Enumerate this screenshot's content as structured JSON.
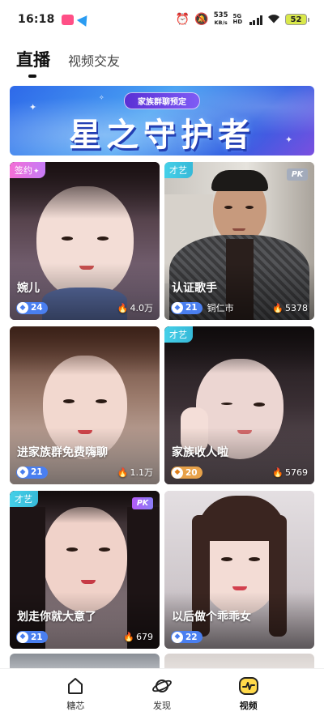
{
  "status_bar": {
    "time": "16:18",
    "net_speed_value": "535",
    "net_speed_unit": "KB/s",
    "network_type": "5G HD",
    "battery": "52"
  },
  "tabs": [
    {
      "label": "直播",
      "active": true
    },
    {
      "label": "视频交友",
      "active": false
    }
  ],
  "banner": {
    "pill_text": "家族群聊预定",
    "title": "星之守护者"
  },
  "cards": [
    {
      "tag": "签约",
      "tag_style": "pink",
      "pk": false,
      "title": "婉儿",
      "level": "24",
      "level_style": "blue",
      "city": "",
      "heat": "4.0万"
    },
    {
      "tag": "才艺",
      "tag_style": "teal",
      "pk": true,
      "pk_style": "grey",
      "title": "认证歌手",
      "level": "21",
      "level_style": "blue",
      "city": "铜仁市",
      "heat": "5378"
    },
    {
      "tag": "",
      "tag_style": "",
      "pk": false,
      "title": "进家族群免费嗨聊",
      "level": "21",
      "level_style": "blue",
      "city": "",
      "heat": "1.1万"
    },
    {
      "tag": "才艺",
      "tag_style": "teal",
      "pk": false,
      "title": "家族收人啦",
      "level": "20",
      "level_style": "orange",
      "city": "",
      "heat": "5769"
    },
    {
      "tag": "才艺",
      "tag_style": "teal",
      "pk": true,
      "pk_style": "purple",
      "title": "划走你就大意了",
      "level": "21",
      "level_style": "blue",
      "city": "",
      "heat": "679"
    },
    {
      "tag": "",
      "tag_style": "",
      "pk": false,
      "title": "以后做个乖乖女",
      "level": "22",
      "level_style": "blue",
      "city": "",
      "heat": ""
    }
  ],
  "bottom_nav": [
    {
      "label": "糖芯",
      "icon": "house-icon",
      "active": false
    },
    {
      "label": "发现",
      "icon": "planet-icon",
      "active": false
    },
    {
      "label": "视频",
      "icon": "pulse-icon",
      "active": true
    }
  ],
  "colors": {
    "accent_yellow": "#ffd94a",
    "tag_teal": "#45d0e8",
    "tag_pink": "#f46fd6",
    "level_blue": "#4a7ff0",
    "level_orange": "#e8a24a",
    "flame_red": "#ff5a3c"
  },
  "pk_label": "PK"
}
